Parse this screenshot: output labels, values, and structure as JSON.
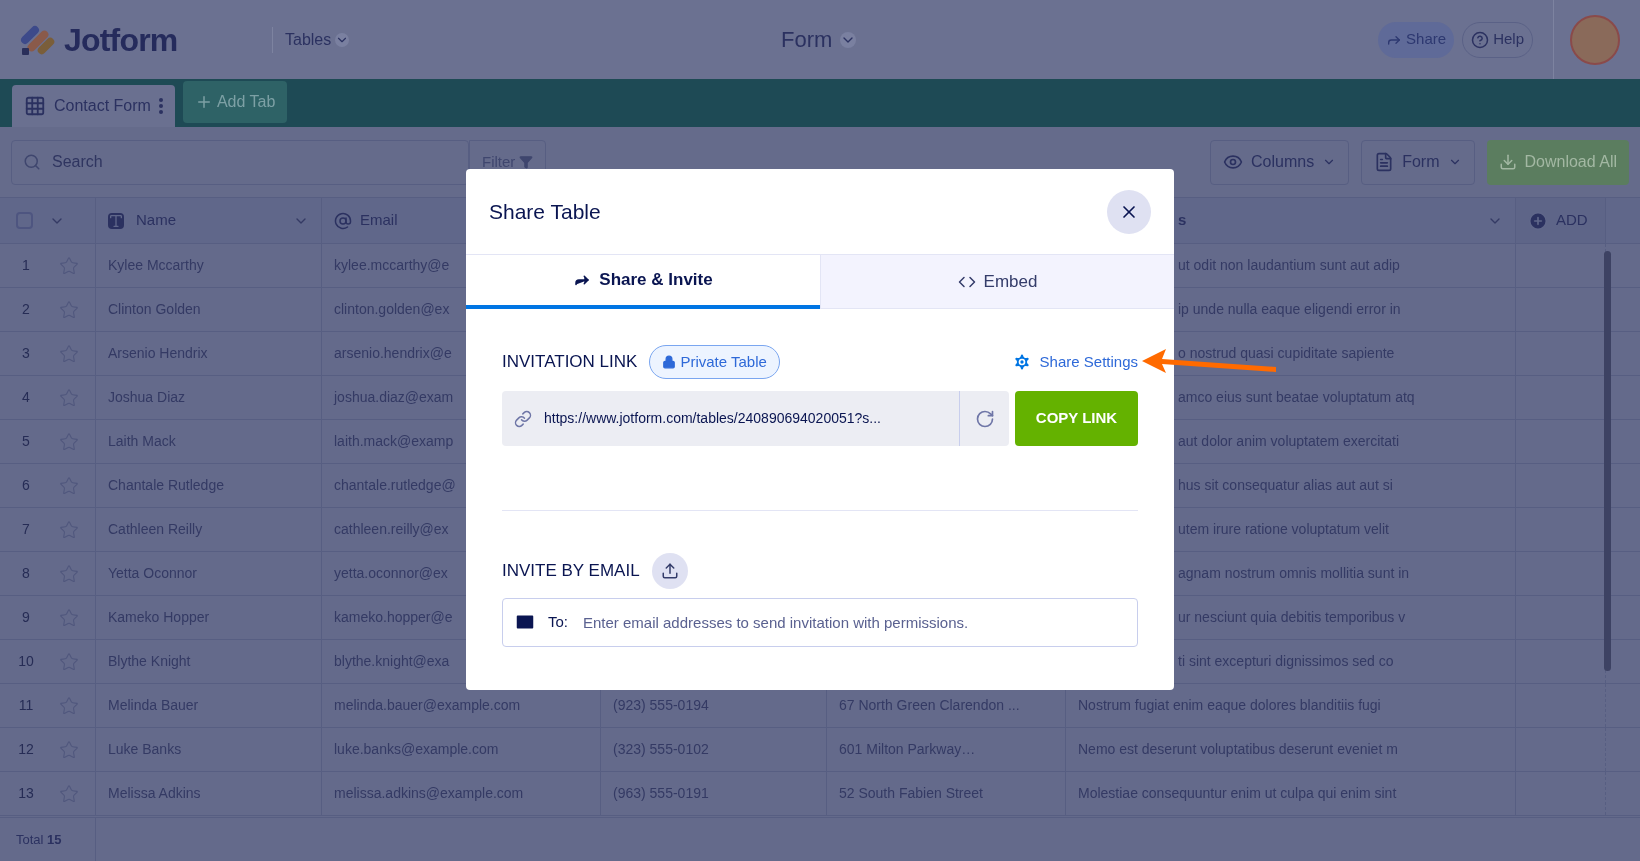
{
  "header": {
    "logo_text": "Jotform",
    "workspace": "Tables",
    "title": "Form",
    "share": "Share",
    "help": "Help"
  },
  "tabs": [
    {
      "label": "Contact Form",
      "selected": true
    }
  ],
  "add_tab": "Add Tab",
  "toolbar": {
    "search_placeholder": "Search",
    "filter": "Filter",
    "columns": "Columns",
    "view": "Form",
    "download": "Download All"
  },
  "table": {
    "select_all_checked": false,
    "headers": {
      "name": "Name",
      "email": "Email",
      "column_6": "s",
      "add": "ADD"
    },
    "rows": [
      {
        "num": "1",
        "starred": false,
        "name": "Kylee Mccarthy",
        "email": "kylee.mccarthy@e",
        "notes": "ut odit non laudantium sunt aut adip"
      },
      {
        "num": "2",
        "starred": false,
        "name": "Clinton Golden",
        "email": "clinton.golden@ex",
        "notes": "ip unde nulla eaque eligendi error in"
      },
      {
        "num": "3",
        "starred": false,
        "name": "Arsenio Hendrix",
        "email": "arsenio.hendrix@e",
        "notes": "o nostrud quasi cupiditate sapiente"
      },
      {
        "num": "4",
        "starred": false,
        "name": "Joshua Diaz",
        "email": "joshua.diaz@exam",
        "notes": "amco eius sunt beatae voluptatum atq"
      },
      {
        "num": "5",
        "starred": false,
        "name": "Laith Mack",
        "email": "laith.mack@examp",
        "notes": "aut dolor anim voluptatem exercitati"
      },
      {
        "num": "6",
        "starred": false,
        "name": "Chantale Rutledge",
        "email": "chantale.rutledge@",
        "notes": "hus sit consequatur alias aut aut si"
      },
      {
        "num": "7",
        "starred": false,
        "name": "Cathleen Reilly",
        "email": "cathleen.reilly@ex",
        "notes": "utem irure ratione voluptatum velit"
      },
      {
        "num": "8",
        "starred": false,
        "name": "Yetta Oconnor",
        "email": "yetta.oconnor@ex",
        "notes": "agnam nostrum omnis mollitia sunt in"
      },
      {
        "num": "9",
        "starred": false,
        "name": "Kameko Hopper",
        "email": "kameko.hopper@e",
        "notes": "ur nesciunt quia debitis temporibus v"
      },
      {
        "num": "10",
        "starred": false,
        "name": "Blythe Knight",
        "email": "blythe.knight@exa",
        "notes": "ti sint excepturi dignissimos sed co"
      },
      {
        "num": "11",
        "starred": false,
        "name": "Melinda Bauer",
        "email": "melinda.bauer@example.com",
        "phone": "(923) 555-0194",
        "address": "67 North Green Clarendon ...",
        "notes": "Nostrum fugiat enim eaque dolores blanditiis fugi"
      },
      {
        "num": "12",
        "starred": false,
        "name": "Luke Banks",
        "email": "luke.banks@example.com",
        "phone": "(323) 555-0102",
        "address": "601 Milton Parkway…",
        "notes": "Nemo est deserunt voluptatibus deserunt eveniet m"
      },
      {
        "num": "13",
        "starred": false,
        "name": "Melissa Adkins",
        "email": "melissa.adkins@example.com",
        "phone": "(963) 555-0191",
        "address": "52 South Fabien Street",
        "notes": "Molestiae consequuntur enim ut culpa qui enim sint"
      }
    ]
  },
  "footer": {
    "total": "Total **15**"
  },
  "modal": {
    "title": "Share Table",
    "tabs": [
      {
        "label": "Share & Invite",
        "kind": "share",
        "selected": true
      },
      {
        "label": "Embed",
        "kind": "embed",
        "selected": false
      }
    ],
    "invitation_label": "INVITATION LINK",
    "badge": "Private Table",
    "share_settings": "Share Settings",
    "link": "https://www.jotform.com/tables/240890694020051?s...",
    "copy": "COPY LINK",
    "invite_label": "INVITE BY EMAIL",
    "to_label": "To:",
    "email_placeholder": "Enter email addresses to send invitation with permissions."
  }
}
